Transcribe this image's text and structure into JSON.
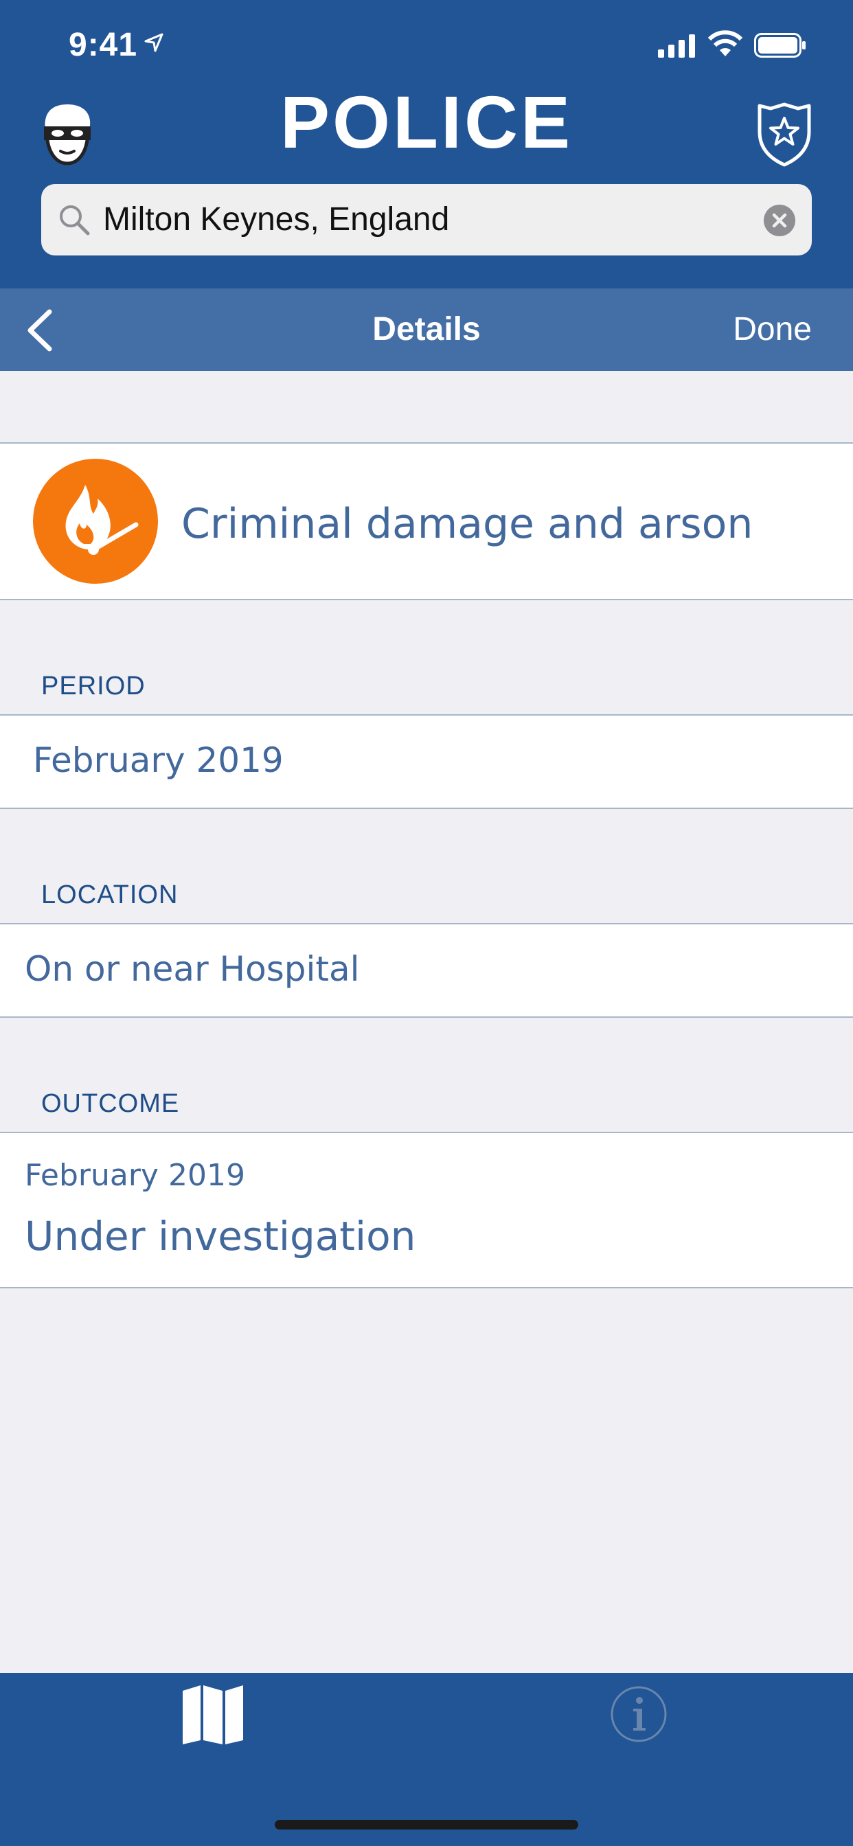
{
  "status_bar": {
    "time": "9:41"
  },
  "header": {
    "title": "POLICE",
    "search_value": "Milton Keynes, England"
  },
  "nav": {
    "title": "Details",
    "done_label": "Done"
  },
  "crime": {
    "category": "Criminal damage and arson",
    "icon": "burning-match-icon",
    "icon_color": "#f5780f"
  },
  "period": {
    "header": "PERIOD",
    "value": "February 2019"
  },
  "location": {
    "header": "LOCATION",
    "value": "On or near Hospital"
  },
  "outcome": {
    "header": "OUTCOME",
    "date": "February 2019",
    "status": "Under investigation"
  },
  "tabs": [
    {
      "icon": "map-icon"
    },
    {
      "icon": "info-icon"
    }
  ],
  "colors": {
    "brand_blue": "#225595",
    "nav_blue": "#446fa6",
    "text_blue": "#42689c"
  }
}
